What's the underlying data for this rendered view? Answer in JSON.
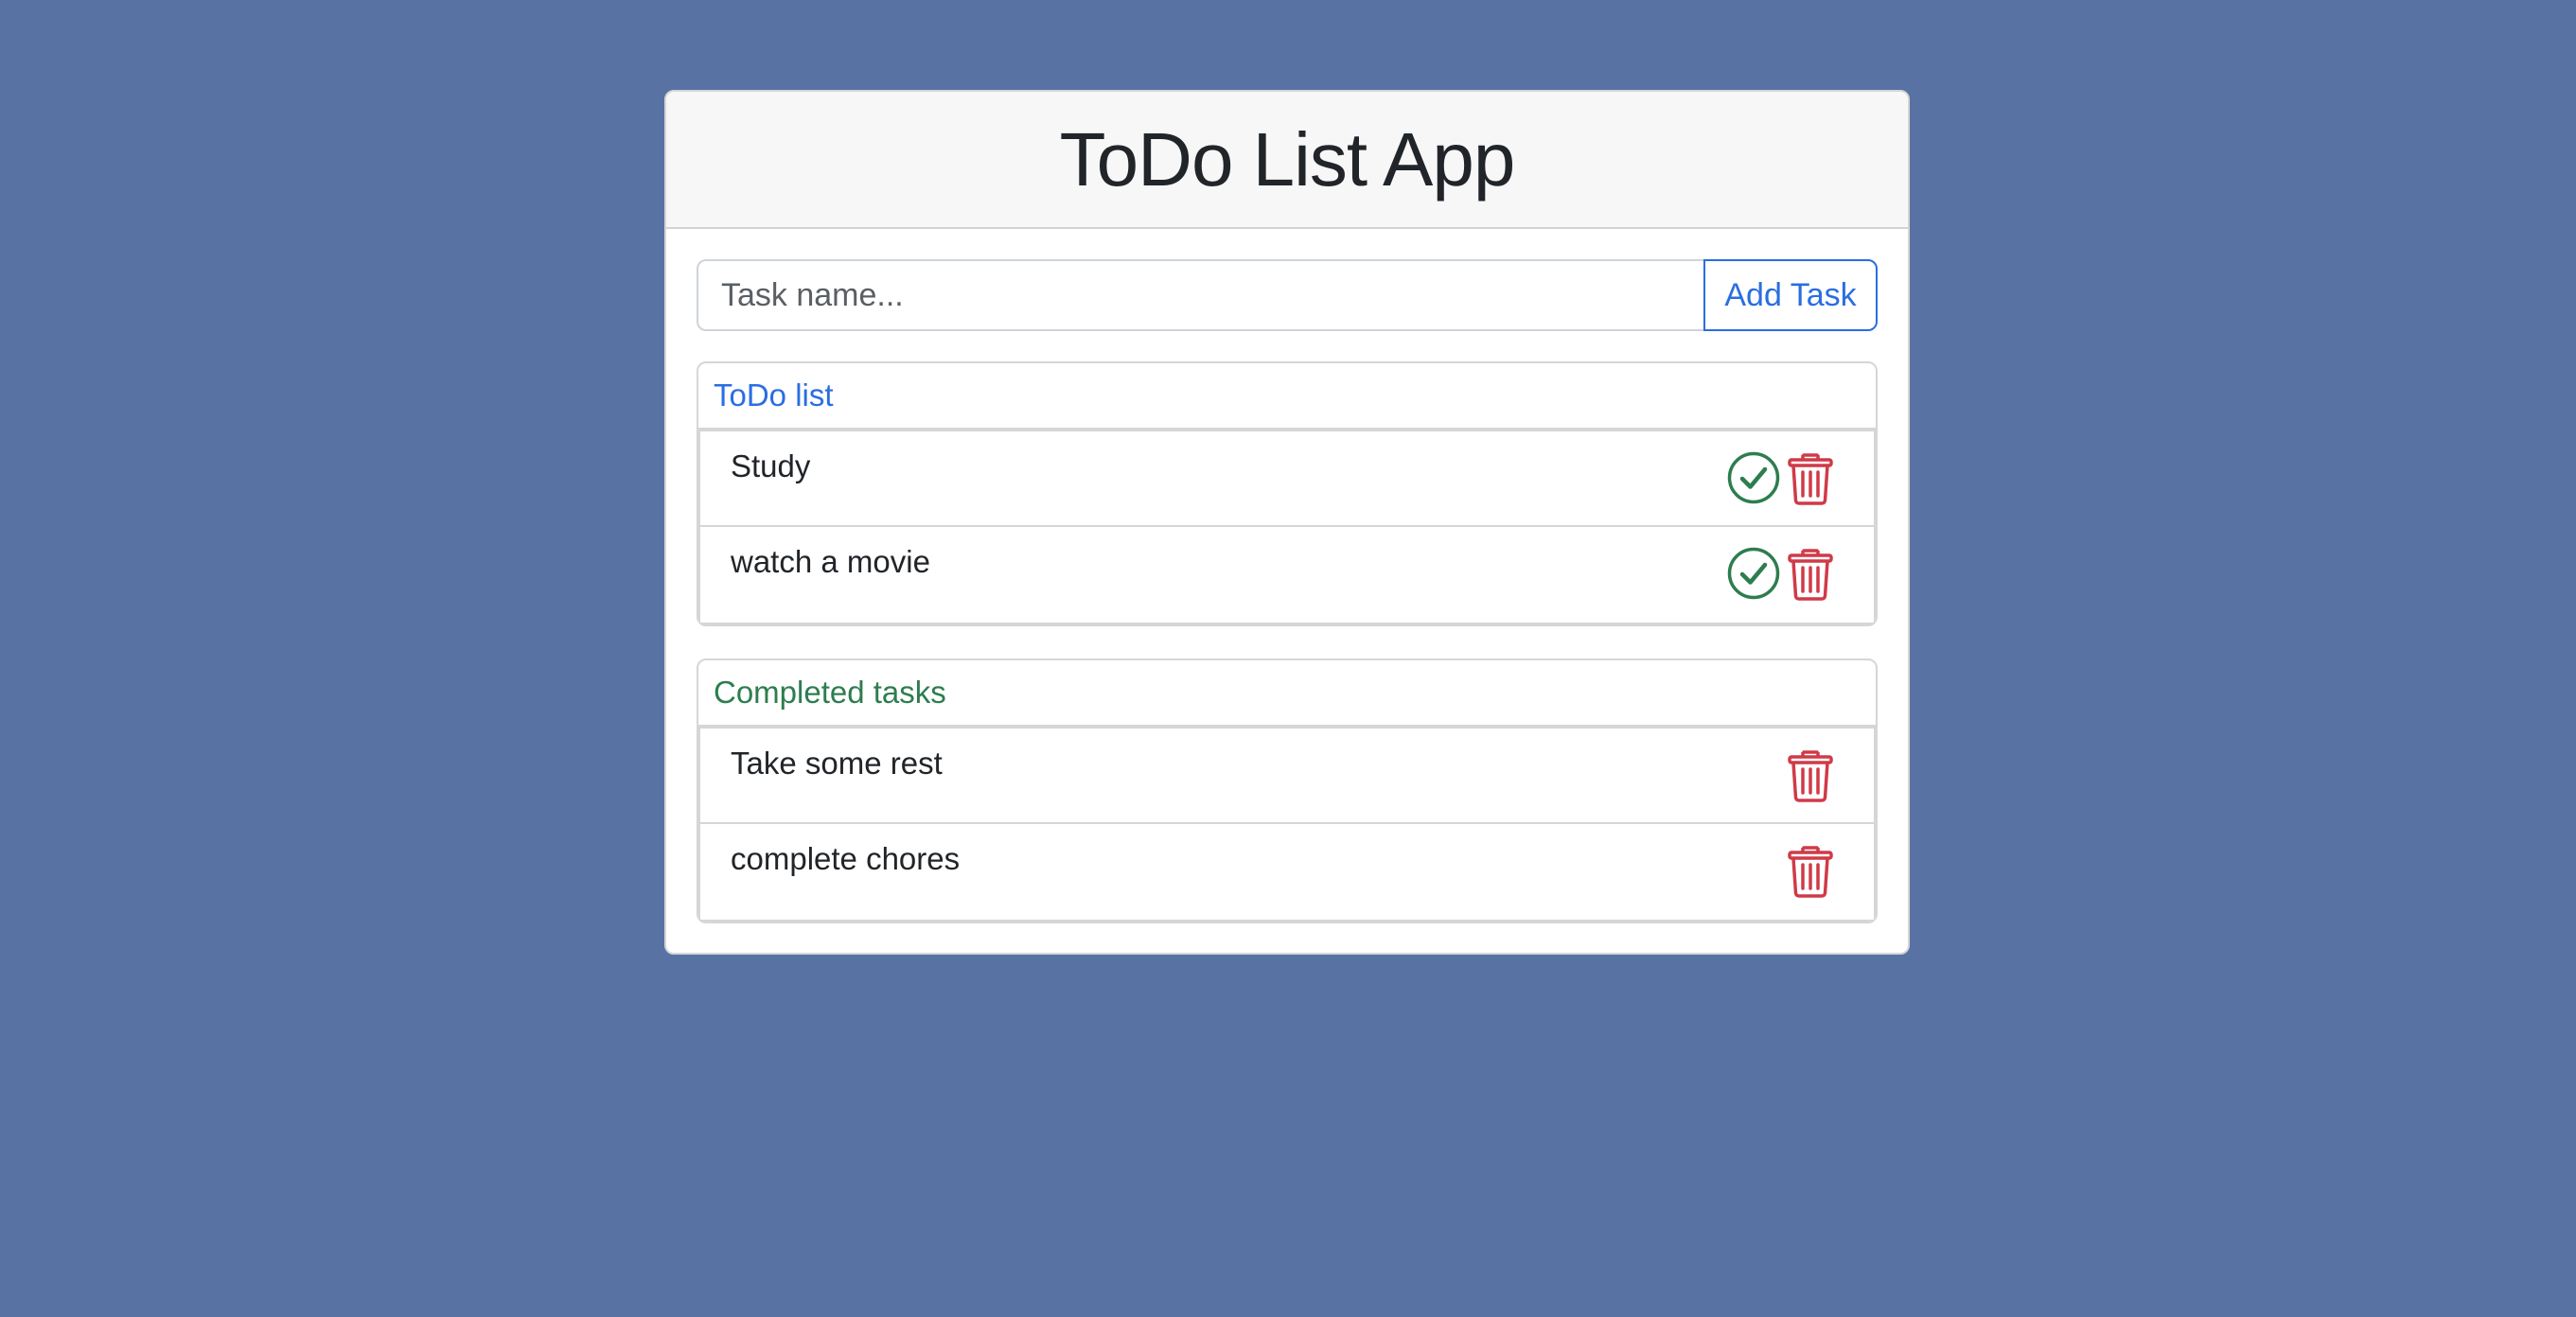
{
  "header": {
    "title": "ToDo List App"
  },
  "new_task": {
    "placeholder": "Task name...",
    "value": "",
    "add_label": "Add Task"
  },
  "todo_section": {
    "title": "ToDo list",
    "items": [
      {
        "name": "Study"
      },
      {
        "name": "watch a movie"
      }
    ]
  },
  "completed_section": {
    "title": "Completed tasks",
    "items": [
      {
        "name": "Take some rest"
      },
      {
        "name": "complete chores"
      }
    ]
  },
  "icons": {
    "complete": "check-circle-icon",
    "delete": "trash-icon"
  },
  "colors": {
    "background": "#5872a3",
    "primary": "#2a6ee0",
    "success": "#2e7d4f",
    "danger": "#d03a48"
  }
}
